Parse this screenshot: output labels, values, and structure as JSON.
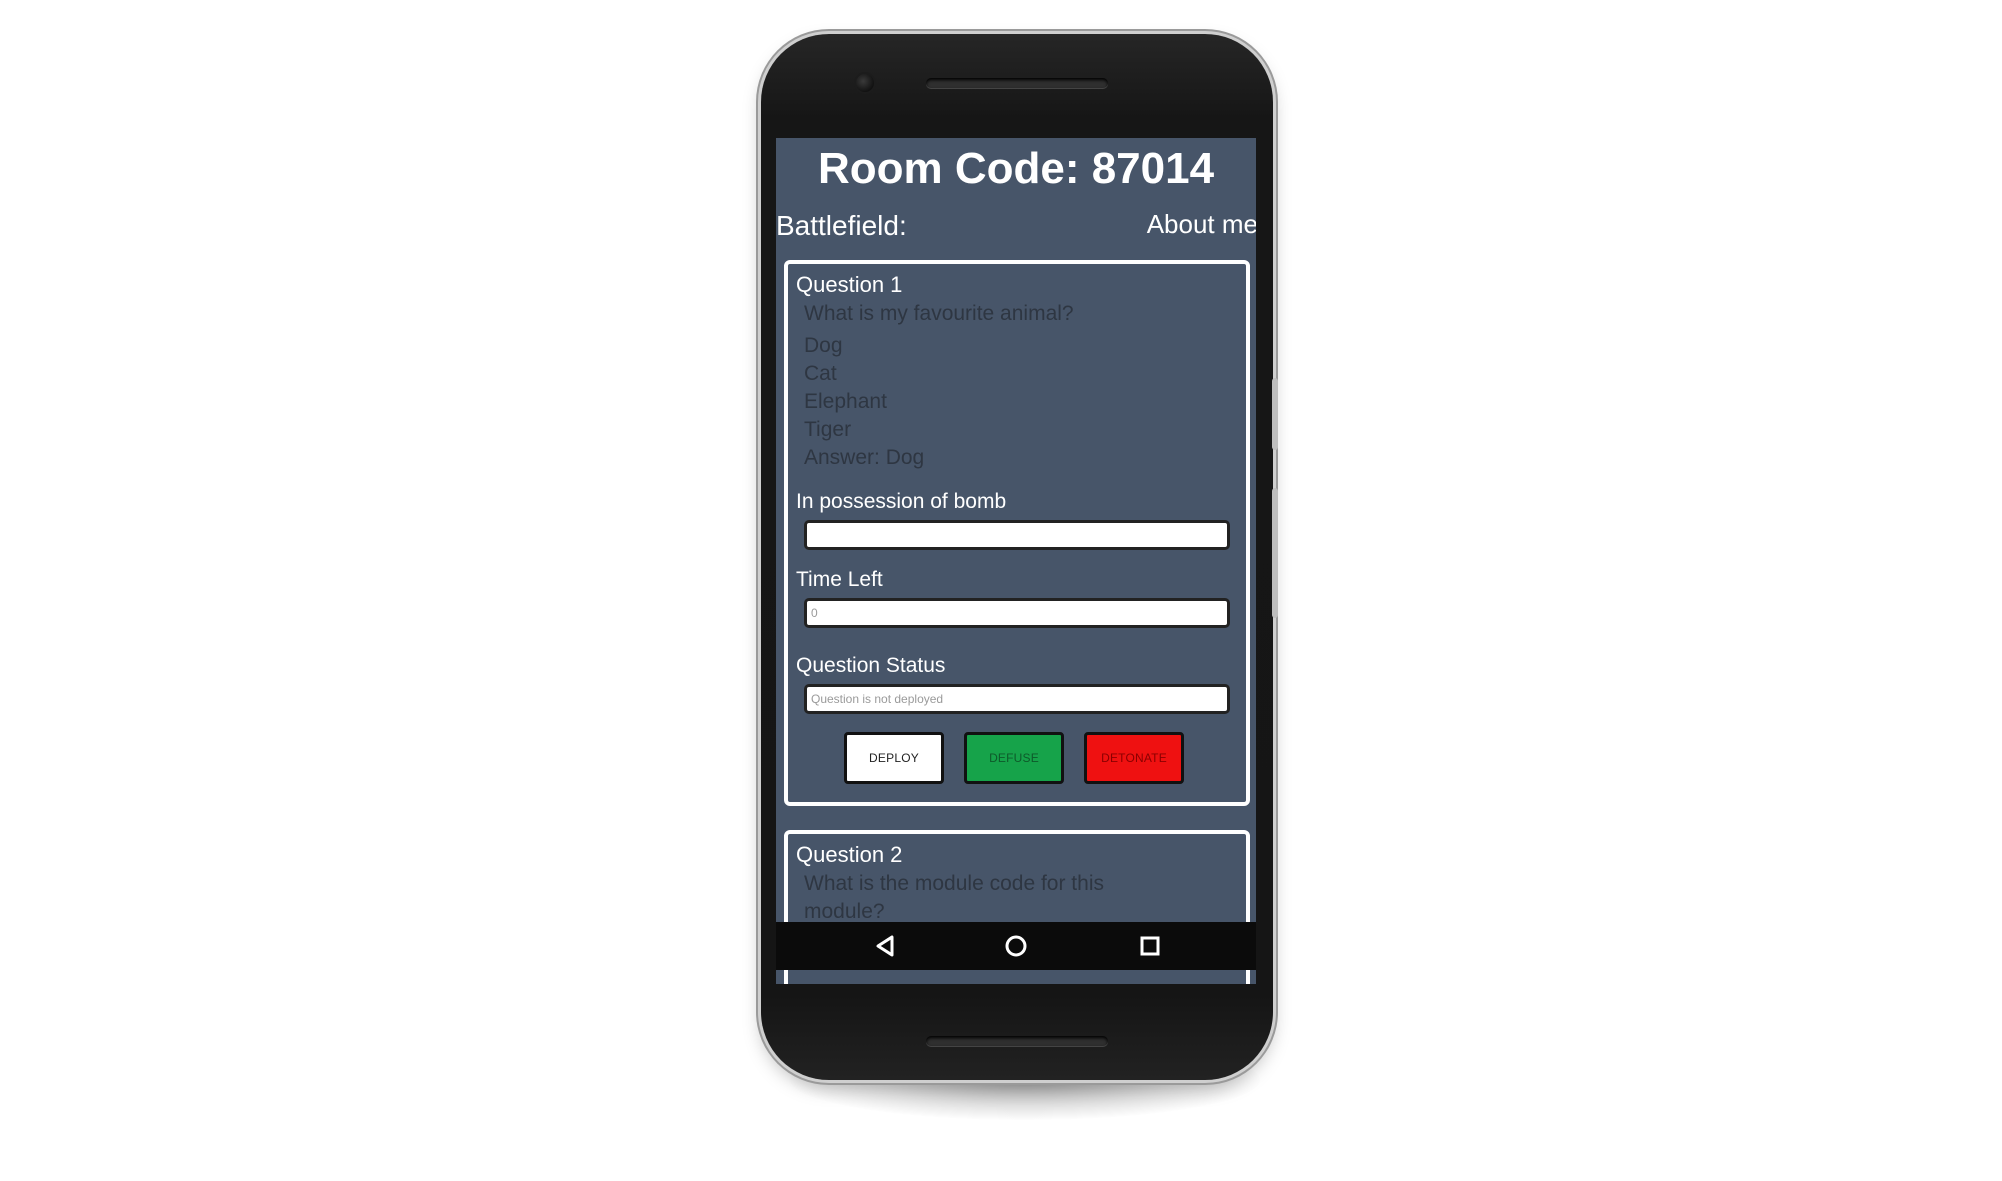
{
  "header": {
    "room_code_label": "Room Code: 87014"
  },
  "nav": {
    "battlefield_label": "Battlefield:",
    "about_label": "About me"
  },
  "questions": [
    {
      "title": "Question 1",
      "text": "What is my favourite animal?",
      "options": [
        "Dog",
        "Cat",
        "Elephant",
        "Tiger"
      ],
      "answer": "Answer: Dog",
      "possession_label": "In possession of bomb",
      "possession_value": "",
      "time_label": "Time Left",
      "time_value": "0",
      "status_label": "Question Status",
      "status_value": "Question is not deployed",
      "buttons": {
        "deploy": "DEPLOY",
        "defuse": "DEFUSE",
        "detonate": "DETONATE"
      }
    },
    {
      "title": "Question 2",
      "text": "What is the module code for this module?"
    }
  ],
  "colors": {
    "screen_background": "#475569",
    "deploy_button": "#ffffff",
    "defuse_button": "#16a34a",
    "detonate_button": "#ef1111"
  },
  "system_nav": {
    "back_icon": "back-triangle-icon",
    "home_icon": "home-circle-icon",
    "recents_icon": "recents-square-icon"
  }
}
